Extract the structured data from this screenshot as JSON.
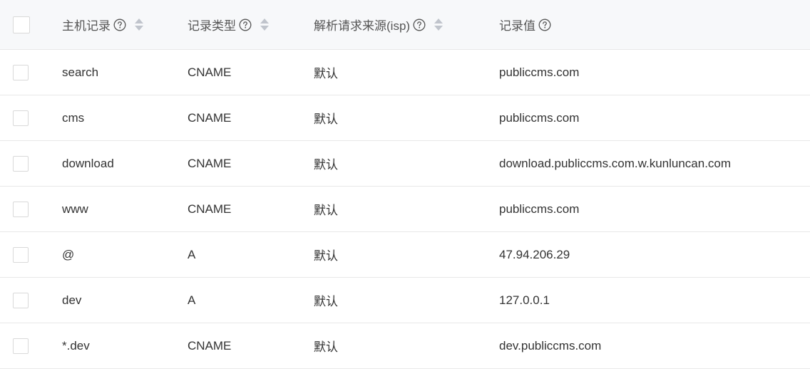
{
  "table": {
    "columns": {
      "host": "主机记录",
      "type": "记录类型",
      "isp": "解析请求来源(isp)",
      "value": "记录值"
    },
    "rows": [
      {
        "host": "search",
        "type": "CNAME",
        "isp": "默认",
        "value": "publiccms.com"
      },
      {
        "host": "cms",
        "type": "CNAME",
        "isp": "默认",
        "value": "publiccms.com"
      },
      {
        "host": "download",
        "type": "CNAME",
        "isp": "默认",
        "value": "download.publiccms.com.w.kunluncan.com"
      },
      {
        "host": "www",
        "type": "CNAME",
        "isp": "默认",
        "value": "publiccms.com"
      },
      {
        "host": "@",
        "type": "A",
        "isp": "默认",
        "value": "47.94.206.29"
      },
      {
        "host": "dev",
        "type": "A",
        "isp": "默认",
        "value": "127.0.0.1"
      },
      {
        "host": "*.dev",
        "type": "CNAME",
        "isp": "默认",
        "value": "dev.publiccms.com"
      }
    ]
  },
  "icons": {
    "help": "question-circle-icon",
    "sort": "sort-icon"
  },
  "colors": {
    "header_bg": "#f7f8fa",
    "border": "#e8e8e8",
    "text": "#333333",
    "icon": "#c0c4cc"
  }
}
